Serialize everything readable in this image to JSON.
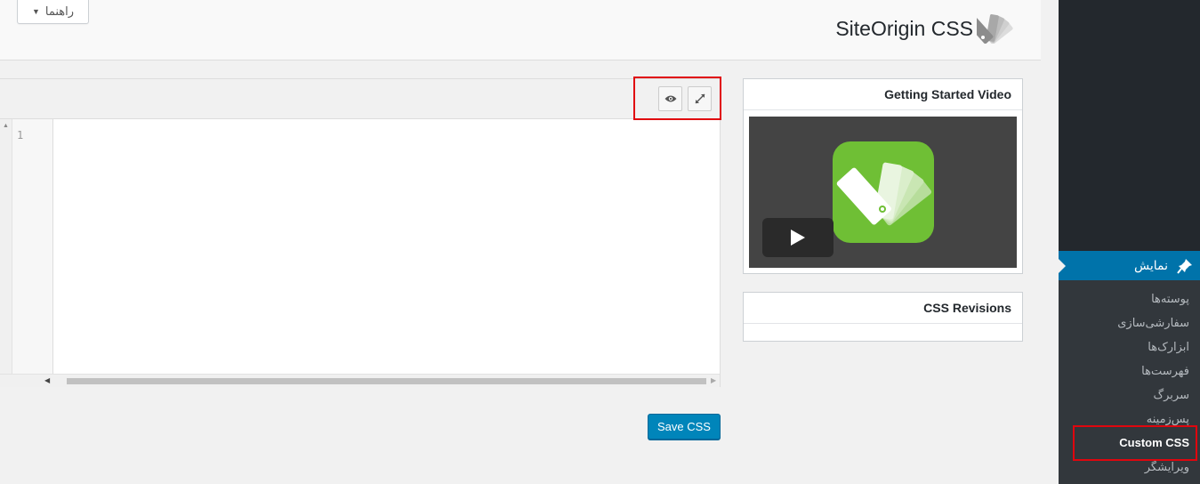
{
  "header": {
    "help_label": "راهنما",
    "page_title": "SiteOrigin CSS"
  },
  "editor": {
    "line_numbers": [
      "1"
    ],
    "save_label": "Save CSS"
  },
  "panels": {
    "video_title": "Getting Started Video",
    "revisions_title": "CSS Revisions"
  },
  "sidebar": {
    "current_menu": "نمایش",
    "submenu": [
      {
        "label": "پوسته‌ها",
        "active": false
      },
      {
        "label": "سفارشی‌سازی",
        "active": false
      },
      {
        "label": "ابزارک‌ها",
        "active": false
      },
      {
        "label": "فهرست‌ها",
        "active": false
      },
      {
        "label": "سربرگ",
        "active": false
      },
      {
        "label": "پس‌زمینه",
        "active": false
      },
      {
        "label": "Custom CSS",
        "active": true
      },
      {
        "label": "ویرایشگر",
        "active": false
      }
    ]
  },
  "colors": {
    "accent": "#0073aa",
    "button": "#0085ba",
    "highlight": "#e0060e",
    "sidebar": "#23282d",
    "submenu": "#32373c",
    "app_icon": "#6fbf35"
  },
  "icons": [
    "caret-down-icon",
    "siteorigin-logo-icon",
    "eye-icon",
    "expand-icon",
    "play-icon",
    "pin-icon"
  ]
}
